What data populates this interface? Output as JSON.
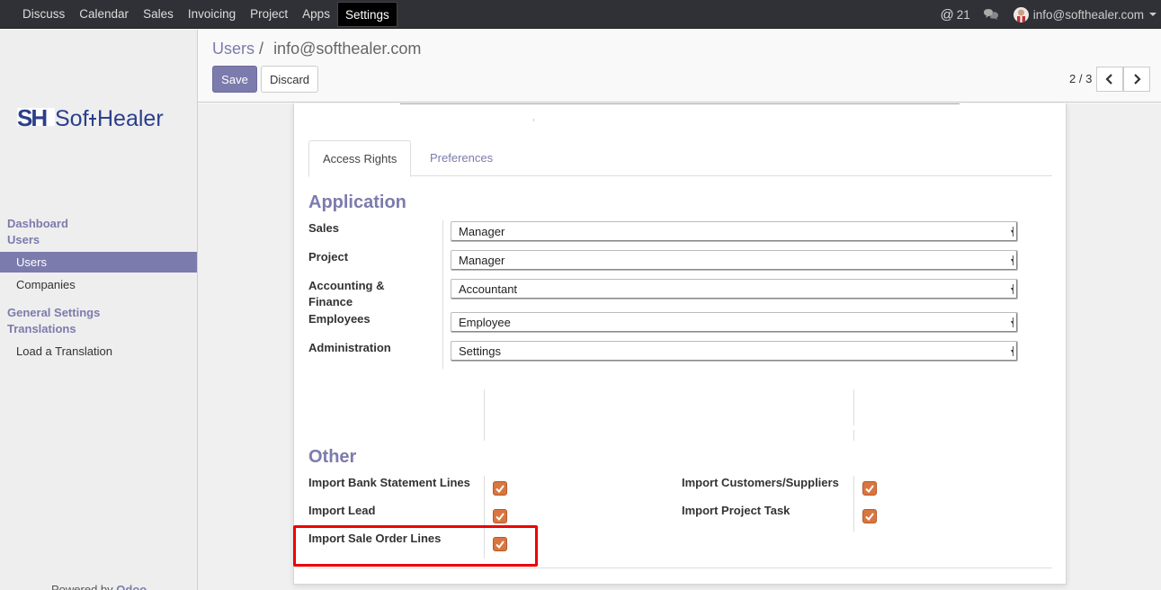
{
  "topbar": {
    "menu": [
      "Discuss",
      "Calendar",
      "Sales",
      "Invoicing",
      "Project",
      "Apps",
      "Settings"
    ],
    "active_menu": "Settings",
    "mention_count": "21",
    "user_email": "info@softhealer.com"
  },
  "sidebar": {
    "logo_text": "SoftHealer",
    "heading_dashboard": "Dashboard",
    "heading_users": "Users",
    "item_users": "Users",
    "item_companies": "Companies",
    "heading_general_settings": "General Settings",
    "heading_translations": "Translations",
    "item_load_translation": "Load a Translation",
    "powered_by": "Powered by",
    "powered_brand": "Odoo"
  },
  "control_panel": {
    "breadcrumb_parent": "Users",
    "breadcrumb_sep": "/",
    "breadcrumb_current": "info@softhealer.com",
    "save_label": "Save",
    "discard_label": "Discard",
    "pager": "2 / 3"
  },
  "form": {
    "tabs": [
      "Access Rights",
      "Preferences"
    ],
    "application_title": "Application",
    "fields": [
      {
        "label": "Sales",
        "value": "Manager"
      },
      {
        "label": "Project",
        "value": "Manager"
      },
      {
        "label": "Accounting & Finance",
        "value": "Accountant"
      },
      {
        "label": "Employees",
        "value": "Employee"
      },
      {
        "label": "Administration",
        "value": "Settings"
      }
    ],
    "other_title": "Other",
    "checkboxes": [
      {
        "label": "Import Bank Statement Lines",
        "checked": true
      },
      {
        "label": "Import Customers/Suppliers",
        "checked": true
      },
      {
        "label": "Import Lead",
        "checked": true
      },
      {
        "label": "Import Project Task",
        "checked": true
      },
      {
        "label": "Import Sale Order Lines",
        "checked": true
      }
    ]
  },
  "colors": {
    "accent": "#7c7bad",
    "checkbox": "#d9763f",
    "highlight": "#e00000",
    "topbar": "#2f3136"
  }
}
